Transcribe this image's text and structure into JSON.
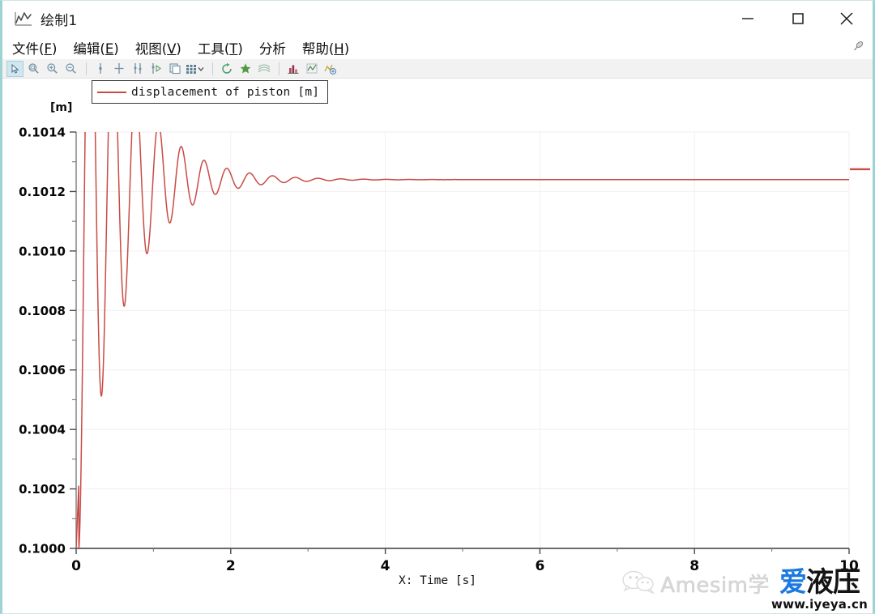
{
  "window": {
    "title": "绘制1",
    "icon": "chart-line-icon",
    "controls": {
      "minimize": "−",
      "maximize": "□",
      "close": "✕"
    },
    "border_color": "#9ed3d3"
  },
  "menu": {
    "items": [
      {
        "label": "文件(F)",
        "text": "文件",
        "mnemonic": "F",
        "name": "menu-file"
      },
      {
        "label": "编辑(E)",
        "text": "编辑",
        "mnemonic": "E",
        "name": "menu-edit"
      },
      {
        "label": "视图(V)",
        "text": "视图",
        "mnemonic": "V",
        "name": "menu-view"
      },
      {
        "label": "工具(T)",
        "text": "工具",
        "mnemonic": "T",
        "name": "menu-tools"
      },
      {
        "label": "分析",
        "text": "分析",
        "mnemonic": "",
        "name": "menu-analysis"
      },
      {
        "label": "帮助(H)",
        "text": "帮助",
        "mnemonic": "H",
        "name": "menu-help"
      }
    ],
    "pin_icon": "pin-icon"
  },
  "toolbar": {
    "items": [
      {
        "name": "pointer-select-icon",
        "selected": true
      },
      {
        "name": "zoom-region-icon",
        "selected": false
      },
      {
        "name": "zoom-in-icon",
        "selected": false
      },
      {
        "name": "zoom-out-icon",
        "selected": false
      },
      {
        "name": "single-cursor-icon",
        "selected": false
      },
      {
        "name": "cross-cursor-icon",
        "selected": false
      },
      {
        "name": "double-cursor-icon",
        "selected": false
      },
      {
        "name": "cursor-play-icon",
        "selected": false
      },
      {
        "name": "copy-window-icon",
        "selected": false
      },
      {
        "name": "grid-layout-icon",
        "selected": false
      },
      {
        "name": "refresh-icon",
        "selected": false
      },
      {
        "name": "clear-plot-icon",
        "selected": false
      },
      {
        "name": "curve-stack-icon",
        "selected": false
      },
      {
        "name": "bar-chart-icon",
        "selected": false
      },
      {
        "name": "line-chart-icon",
        "selected": false
      },
      {
        "name": "add-plot-icon",
        "selected": false
      }
    ]
  },
  "chart_data": {
    "type": "line",
    "title": "",
    "legend": {
      "entries": [
        {
          "label": "displacement of piston [m]",
          "color": "#c94b45"
        }
      ],
      "position": "top-left",
      "boxed": true
    },
    "xlabel": "X: Time [s]",
    "ylabel": "[m]",
    "xlim": [
      0,
      10
    ],
    "ylim": [
      0.1,
      0.1014
    ],
    "xticks": [
      "0",
      "2",
      "4",
      "6",
      "8",
      "10"
    ],
    "xtick_values": [
      0,
      2,
      4,
      6,
      8,
      10
    ],
    "yticks": [
      "0.1000",
      "0.1002",
      "0.1004",
      "0.1006",
      "0.1008",
      "0.1010",
      "0.1012",
      "0.1014"
    ],
    "ytick_values": [
      0.1,
      0.1002,
      0.1004,
      0.1006,
      0.1008,
      0.101,
      0.1012,
      0.1014
    ],
    "minor_ticks_per_interval": 2,
    "grid": true,
    "grid_color": "#f4eef0",
    "axis_color": "#8a8a8a",
    "series": [
      {
        "name": "displacement of piston [m]",
        "color": "#c94b45",
        "description": "Underdamped second-order step response of a hydraulic piston position; starts at 0.1000 m at t=0, rises sharply, overshoots to a first peak near 0.10137 m at t~0.16 s, then oscillates with exponentially decaying amplitude about the steady-state value 0.101240 m, fully settled by t~2.2 s and flat thereafter until t=10 s.",
        "model": "damped_sine_step",
        "steady_state": 0.10124,
        "initial_value": 0.1,
        "t_start": 0.0,
        "rise_start": 0.035,
        "damping_tau": 0.55,
        "period": 0.295,
        "first_peak": {
          "t": 0.16,
          "y": 0.10137
        },
        "first_trough": {
          "t": 0.305,
          "y": 0.100515
        },
        "peaks": [
          {
            "t": 0.16,
            "y": 0.10137
          },
          {
            "t": 0.455,
            "y": 0.101338
          },
          {
            "t": 0.75,
            "y": 0.101318
          },
          {
            "t": 1.045,
            "y": 0.1013
          },
          {
            "t": 1.34,
            "y": 0.101285
          },
          {
            "t": 1.635,
            "y": 0.101272
          },
          {
            "t": 1.93,
            "y": 0.101262
          }
        ],
        "troughs": [
          {
            "t": 0.305,
            "y": 0.100515
          },
          {
            "t": 0.6,
            "y": 0.10074
          },
          {
            "t": 0.895,
            "y": 0.100905
          },
          {
            "t": 1.19,
            "y": 0.10102
          },
          {
            "t": 1.485,
            "y": 0.1011
          },
          {
            "t": 1.78,
            "y": 0.101155
          },
          {
            "t": 2.075,
            "y": 0.101195
          }
        ]
      }
    ],
    "right_edge_marker": {
      "color": "#c94b45",
      "y_value": 0.101275
    }
  },
  "watermark": {
    "wechat_icon": "wechat-icon",
    "amesim_text": "Amesim学",
    "cn_text_1": "爱",
    "cn_text_2": "液压",
    "cn_color_1": "#1a7ae0",
    "cn_color_2": "#141414",
    "url": "www.iyeya.cn"
  }
}
